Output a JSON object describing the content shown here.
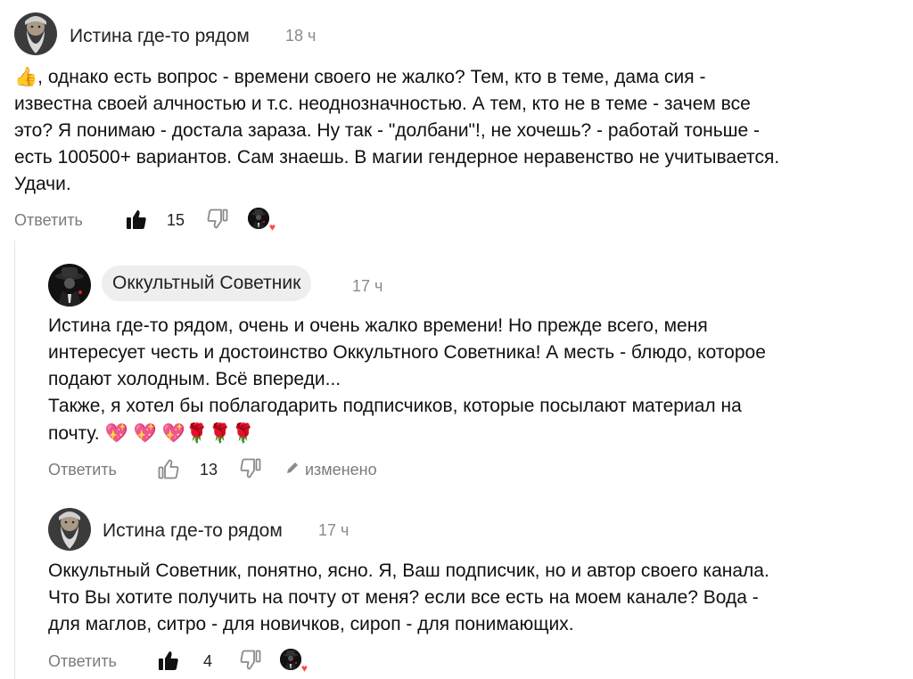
{
  "comments": [
    {
      "author": "Истина где-то рядом",
      "time": "18 ч",
      "thumb_emoji": "👍",
      "lines": [
        ", однако есть вопрос - времени своего не жалко? Тем, кто в теме, дама сия -",
        "известна своей алчностью и т.с. неоднозначностью. А тем, кто не в теме - зачем все",
        "это? Я понимаю - достала зараза. Ну так - \"долбани\"!, не хочешь? - работай тоньше -",
        "есть 100500+ вариантов. Сам знаешь. В магии гендерное неравенство не учитывается.",
        "Удачи."
      ],
      "reply_label": "Ответить",
      "likes": "15",
      "liked": true
    },
    {
      "author": "Оккультный Советник",
      "time": "17 ч",
      "lines": [
        "Истина где-то рядом, очень и очень жалко времени! Но прежде всего, меня",
        "интересует честь и достоинство Оккультного Советника! А месть - блюдо, которое",
        "подают холодным. Всё впереди...",
        "Также, я хотел бы поблагодарить подписчиков, которые посылают материал на",
        "почту. "
      ],
      "emojis": [
        "💖",
        "💖",
        "💖",
        "🌹",
        "🌹",
        "🌹"
      ],
      "reply_label": "Ответить",
      "likes": "13",
      "liked": false,
      "edited_label": "изменено"
    },
    {
      "author": "Истина где-то рядом",
      "time": "17 ч",
      "lines": [
        "Оккультный Советник, понятно, ясно. Я, Ваш подписчик, но и автор своего канала.",
        "Что Вы хотите получить на почту от меня? если все есть на моем канале? Вода -",
        "для маглов, ситро - для новичков, сироп - для понимающих."
      ],
      "reply_label": "Ответить",
      "likes": "4",
      "liked": true
    }
  ],
  "icons": {
    "like": "thumbs-up-icon",
    "dislike": "thumbs-down-icon",
    "edit": "pencil-icon",
    "reaction": "heart-reaction-icon"
  },
  "colors": {
    "muted": "#7b7b7b",
    "author_pill": "#eeeeee",
    "reaction_heart": "#ff4a3d"
  }
}
